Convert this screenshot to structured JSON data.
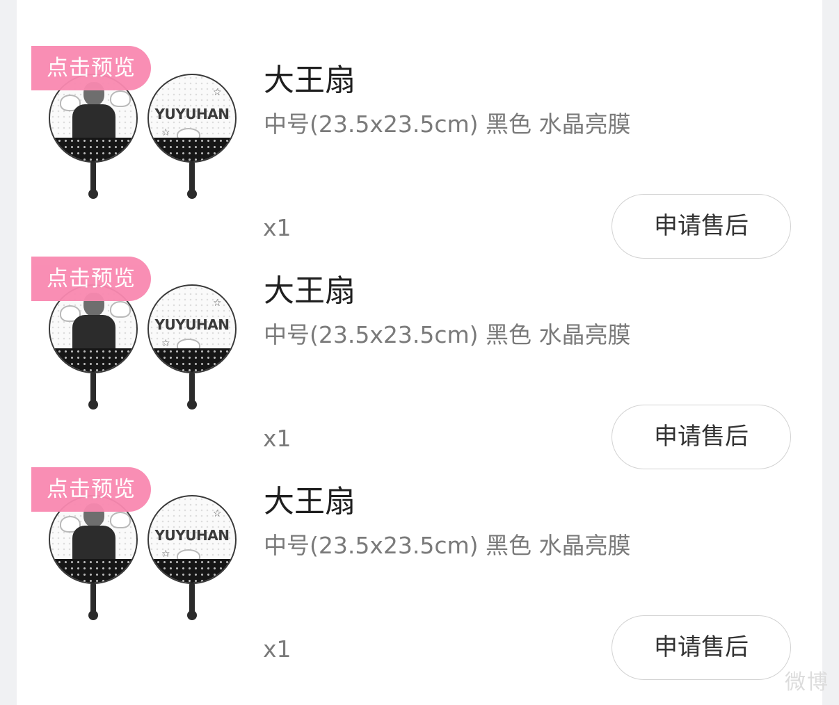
{
  "items": [
    {
      "preview_label": "点击预览",
      "title": "大王扇",
      "spec": "中号(23.5x23.5cm) 黑色 水晶亮膜",
      "quantity": "x1",
      "action_label": "申请售后",
      "fan_brand": "YUYUHAN"
    },
    {
      "preview_label": "点击预览",
      "title": "大王扇",
      "spec": "中号(23.5x23.5cm) 黑色 水晶亮膜",
      "quantity": "x1",
      "action_label": "申请售后",
      "fan_brand": "YUYUHAN"
    },
    {
      "preview_label": "点击预览",
      "title": "大王扇",
      "spec": "中号(23.5x23.5cm) 黑色 水晶亮膜",
      "quantity": "x1",
      "action_label": "申请售后",
      "fan_brand": "YUYUHAN"
    }
  ],
  "colors": {
    "preview_tag": "#f989b0",
    "page_background": "#f0f1f3",
    "card_background": "#ffffff"
  },
  "watermark": "微博"
}
